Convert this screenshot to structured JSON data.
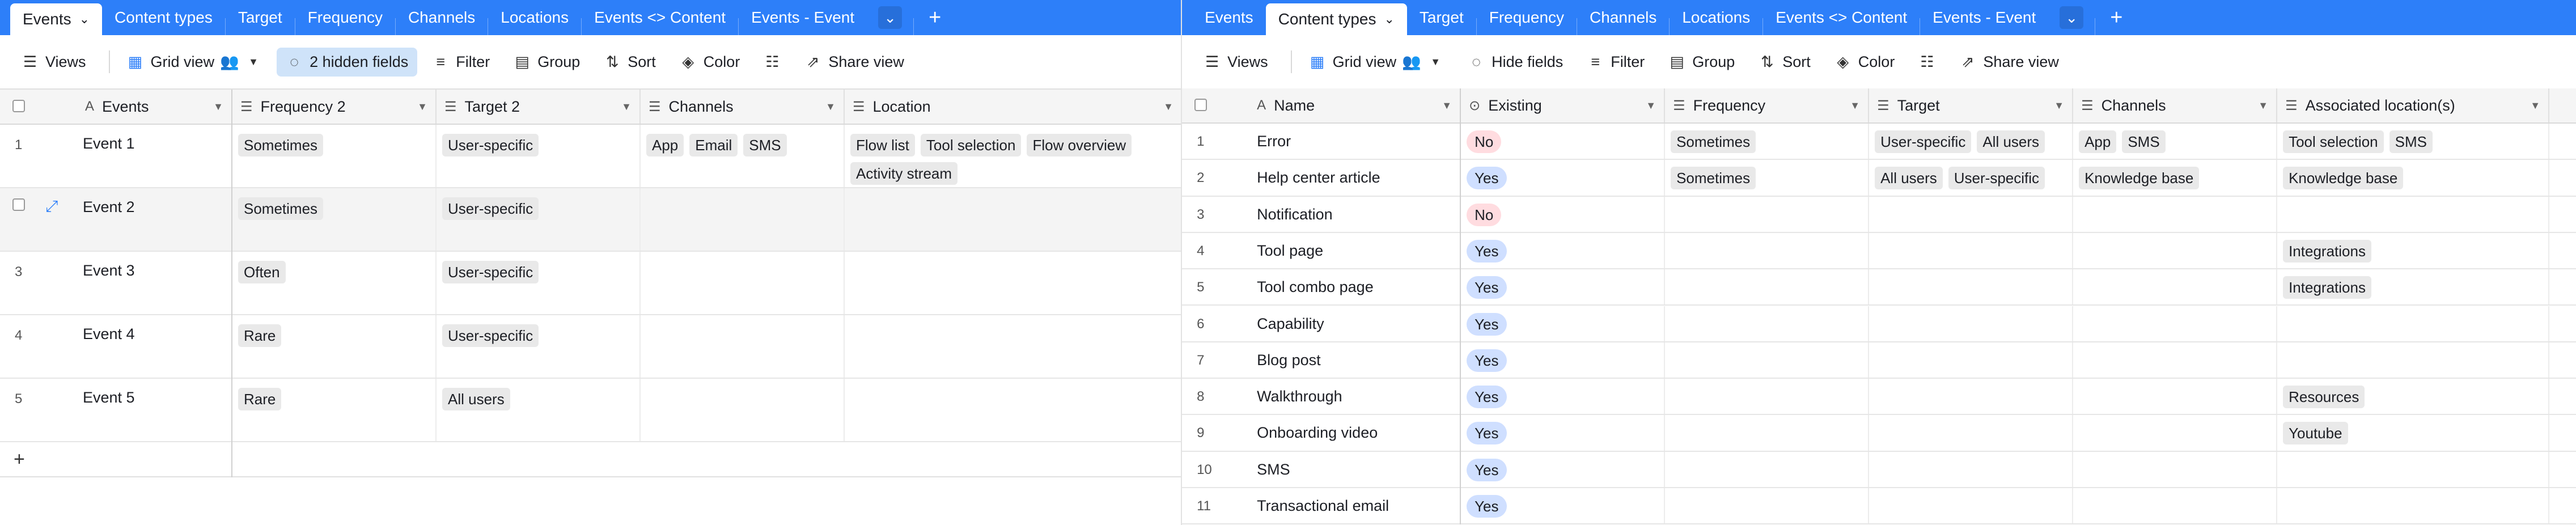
{
  "left": {
    "tabs": [
      {
        "label": "Events",
        "active": true
      },
      {
        "label": "Content types"
      },
      {
        "label": "Target"
      },
      {
        "label": "Frequency"
      },
      {
        "label": "Channels"
      },
      {
        "label": "Locations"
      },
      {
        "label": "Events <> Content"
      },
      {
        "label": "Events - Event"
      }
    ],
    "toolbar": {
      "views": "Views",
      "grid_view": "Grid view",
      "hidden_fields": "2 hidden fields",
      "filter": "Filter",
      "group": "Group",
      "sort": "Sort",
      "color": "Color",
      "share_view": "Share view"
    },
    "columns": [
      {
        "label": "Events",
        "icon": "A"
      },
      {
        "label": "Frequency 2",
        "icon": "☰"
      },
      {
        "label": "Target 2",
        "icon": "☰"
      },
      {
        "label": "Channels",
        "icon": "☰"
      },
      {
        "label": "Location",
        "icon": "☰"
      }
    ],
    "rows": [
      {
        "num": "1",
        "name": "Event 1",
        "frequency": [
          "Sometimes"
        ],
        "target": [
          "User-specific"
        ],
        "channels": [
          "App",
          "Email",
          "SMS"
        ],
        "location": [
          "Flow list",
          "Tool selection",
          "Flow overview",
          "Activity stream"
        ]
      },
      {
        "num": "",
        "name": "Event 2",
        "frequency": [
          "Sometimes"
        ],
        "target": [
          "User-specific"
        ],
        "channels": [],
        "location": []
      },
      {
        "num": "3",
        "name": "Event 3",
        "frequency": [
          "Often"
        ],
        "target": [
          "User-specific"
        ],
        "channels": [],
        "location": []
      },
      {
        "num": "4",
        "name": "Event 4",
        "frequency": [
          "Rare"
        ],
        "target": [
          "User-specific"
        ],
        "channels": [],
        "location": []
      },
      {
        "num": "5",
        "name": "Event 5",
        "frequency": [
          "Rare"
        ],
        "target": [
          "All users"
        ],
        "channels": [],
        "location": []
      }
    ],
    "add_label": "+"
  },
  "right": {
    "tabs": [
      {
        "label": "Events"
      },
      {
        "label": "Content types",
        "active": true
      },
      {
        "label": "Target"
      },
      {
        "label": "Frequency"
      },
      {
        "label": "Channels"
      },
      {
        "label": "Locations"
      },
      {
        "label": "Events <> Content"
      },
      {
        "label": "Events - Event"
      }
    ],
    "toolbar": {
      "views": "Views",
      "grid_view": "Grid view",
      "hidden_fields": "Hide fields",
      "filter": "Filter",
      "group": "Group",
      "sort": "Sort",
      "color": "Color",
      "share_view": "Share view"
    },
    "columns": [
      {
        "label": "Name",
        "icon": "A"
      },
      {
        "label": "Existing",
        "icon": "⊙"
      },
      {
        "label": "Frequency",
        "icon": "☰"
      },
      {
        "label": "Target",
        "icon": "☰"
      },
      {
        "label": "Channels",
        "icon": "☰"
      },
      {
        "label": "Associated location(s)",
        "icon": "☰"
      }
    ],
    "rows": [
      {
        "num": "1",
        "name": "Error",
        "existing": "No",
        "frequency": [
          "Sometimes"
        ],
        "target": [
          "User-specific",
          "All users"
        ],
        "channels": [
          "App",
          "SMS"
        ],
        "locations": [
          "Tool selection",
          "SMS"
        ]
      },
      {
        "num": "2",
        "name": "Help center article",
        "existing": "Yes",
        "frequency": [
          "Sometimes"
        ],
        "target": [
          "All users",
          "User-specific"
        ],
        "channels": [
          "Knowledge base"
        ],
        "locations": [
          "Knowledge base"
        ]
      },
      {
        "num": "3",
        "name": "Notification",
        "existing": "No",
        "frequency": [],
        "target": [],
        "channels": [],
        "locations": []
      },
      {
        "num": "4",
        "name": "Tool page",
        "existing": "Yes",
        "frequency": [],
        "target": [],
        "channels": [],
        "locations": [
          "Integrations"
        ]
      },
      {
        "num": "5",
        "name": "Tool combo page",
        "existing": "Yes",
        "frequency": [],
        "target": [],
        "channels": [],
        "locations": [
          "Integrations"
        ]
      },
      {
        "num": "6",
        "name": "Capability",
        "existing": "Yes",
        "frequency": [],
        "target": [],
        "channels": [],
        "locations": []
      },
      {
        "num": "7",
        "name": "Blog post",
        "existing": "Yes",
        "frequency": [],
        "target": [],
        "channels": [],
        "locations": []
      },
      {
        "num": "8",
        "name": "Walkthrough",
        "existing": "Yes",
        "frequency": [],
        "target": [],
        "channels": [],
        "locations": [
          "Resources"
        ]
      },
      {
        "num": "9",
        "name": "Onboarding video",
        "existing": "Yes",
        "frequency": [],
        "target": [],
        "channels": [],
        "locations": [
          "Youtube"
        ]
      },
      {
        "num": "10",
        "name": "SMS",
        "existing": "Yes",
        "frequency": [],
        "target": [],
        "channels": [],
        "locations": []
      },
      {
        "num": "11",
        "name": "Transactional email",
        "existing": "Yes",
        "frequency": [],
        "target": [],
        "channels": [],
        "locations": []
      }
    ]
  },
  "colors": {
    "tabbar": "#2d7ff9",
    "hidden_fields_highlight": "#cfe3f9",
    "yes_pill": "#cfdfff",
    "no_pill": "#ffdce0",
    "tag_pill": "#e9e9e9"
  }
}
